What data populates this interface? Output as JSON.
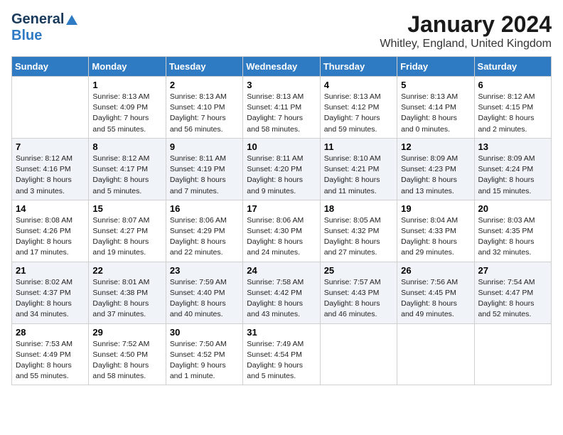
{
  "header": {
    "logo_general": "General",
    "logo_blue": "Blue",
    "title": "January 2024",
    "subtitle": "Whitley, England, United Kingdom"
  },
  "days_of_week": [
    "Sunday",
    "Monday",
    "Tuesday",
    "Wednesday",
    "Thursday",
    "Friday",
    "Saturday"
  ],
  "weeks": [
    [
      {
        "day": "",
        "info": ""
      },
      {
        "day": "1",
        "info": "Sunrise: 8:13 AM\nSunset: 4:09 PM\nDaylight: 7 hours\nand 55 minutes."
      },
      {
        "day": "2",
        "info": "Sunrise: 8:13 AM\nSunset: 4:10 PM\nDaylight: 7 hours\nand 56 minutes."
      },
      {
        "day": "3",
        "info": "Sunrise: 8:13 AM\nSunset: 4:11 PM\nDaylight: 7 hours\nand 58 minutes."
      },
      {
        "day": "4",
        "info": "Sunrise: 8:13 AM\nSunset: 4:12 PM\nDaylight: 7 hours\nand 59 minutes."
      },
      {
        "day": "5",
        "info": "Sunrise: 8:13 AM\nSunset: 4:14 PM\nDaylight: 8 hours\nand 0 minutes."
      },
      {
        "day": "6",
        "info": "Sunrise: 8:12 AM\nSunset: 4:15 PM\nDaylight: 8 hours\nand 2 minutes."
      }
    ],
    [
      {
        "day": "7",
        "info": "Sunrise: 8:12 AM\nSunset: 4:16 PM\nDaylight: 8 hours\nand 3 minutes."
      },
      {
        "day": "8",
        "info": "Sunrise: 8:12 AM\nSunset: 4:17 PM\nDaylight: 8 hours\nand 5 minutes."
      },
      {
        "day": "9",
        "info": "Sunrise: 8:11 AM\nSunset: 4:19 PM\nDaylight: 8 hours\nand 7 minutes."
      },
      {
        "day": "10",
        "info": "Sunrise: 8:11 AM\nSunset: 4:20 PM\nDaylight: 8 hours\nand 9 minutes."
      },
      {
        "day": "11",
        "info": "Sunrise: 8:10 AM\nSunset: 4:21 PM\nDaylight: 8 hours\nand 11 minutes."
      },
      {
        "day": "12",
        "info": "Sunrise: 8:09 AM\nSunset: 4:23 PM\nDaylight: 8 hours\nand 13 minutes."
      },
      {
        "day": "13",
        "info": "Sunrise: 8:09 AM\nSunset: 4:24 PM\nDaylight: 8 hours\nand 15 minutes."
      }
    ],
    [
      {
        "day": "14",
        "info": "Sunrise: 8:08 AM\nSunset: 4:26 PM\nDaylight: 8 hours\nand 17 minutes."
      },
      {
        "day": "15",
        "info": "Sunrise: 8:07 AM\nSunset: 4:27 PM\nDaylight: 8 hours\nand 19 minutes."
      },
      {
        "day": "16",
        "info": "Sunrise: 8:06 AM\nSunset: 4:29 PM\nDaylight: 8 hours\nand 22 minutes."
      },
      {
        "day": "17",
        "info": "Sunrise: 8:06 AM\nSunset: 4:30 PM\nDaylight: 8 hours\nand 24 minutes."
      },
      {
        "day": "18",
        "info": "Sunrise: 8:05 AM\nSunset: 4:32 PM\nDaylight: 8 hours\nand 27 minutes."
      },
      {
        "day": "19",
        "info": "Sunrise: 8:04 AM\nSunset: 4:33 PM\nDaylight: 8 hours\nand 29 minutes."
      },
      {
        "day": "20",
        "info": "Sunrise: 8:03 AM\nSunset: 4:35 PM\nDaylight: 8 hours\nand 32 minutes."
      }
    ],
    [
      {
        "day": "21",
        "info": "Sunrise: 8:02 AM\nSunset: 4:37 PM\nDaylight: 8 hours\nand 34 minutes."
      },
      {
        "day": "22",
        "info": "Sunrise: 8:01 AM\nSunset: 4:38 PM\nDaylight: 8 hours\nand 37 minutes."
      },
      {
        "day": "23",
        "info": "Sunrise: 7:59 AM\nSunset: 4:40 PM\nDaylight: 8 hours\nand 40 minutes."
      },
      {
        "day": "24",
        "info": "Sunrise: 7:58 AM\nSunset: 4:42 PM\nDaylight: 8 hours\nand 43 minutes."
      },
      {
        "day": "25",
        "info": "Sunrise: 7:57 AM\nSunset: 4:43 PM\nDaylight: 8 hours\nand 46 minutes."
      },
      {
        "day": "26",
        "info": "Sunrise: 7:56 AM\nSunset: 4:45 PM\nDaylight: 8 hours\nand 49 minutes."
      },
      {
        "day": "27",
        "info": "Sunrise: 7:54 AM\nSunset: 4:47 PM\nDaylight: 8 hours\nand 52 minutes."
      }
    ],
    [
      {
        "day": "28",
        "info": "Sunrise: 7:53 AM\nSunset: 4:49 PM\nDaylight: 8 hours\nand 55 minutes."
      },
      {
        "day": "29",
        "info": "Sunrise: 7:52 AM\nSunset: 4:50 PM\nDaylight: 8 hours\nand 58 minutes."
      },
      {
        "day": "30",
        "info": "Sunrise: 7:50 AM\nSunset: 4:52 PM\nDaylight: 9 hours\nand 1 minute."
      },
      {
        "day": "31",
        "info": "Sunrise: 7:49 AM\nSunset: 4:54 PM\nDaylight: 9 hours\nand 5 minutes."
      },
      {
        "day": "",
        "info": ""
      },
      {
        "day": "",
        "info": ""
      },
      {
        "day": "",
        "info": ""
      }
    ]
  ]
}
